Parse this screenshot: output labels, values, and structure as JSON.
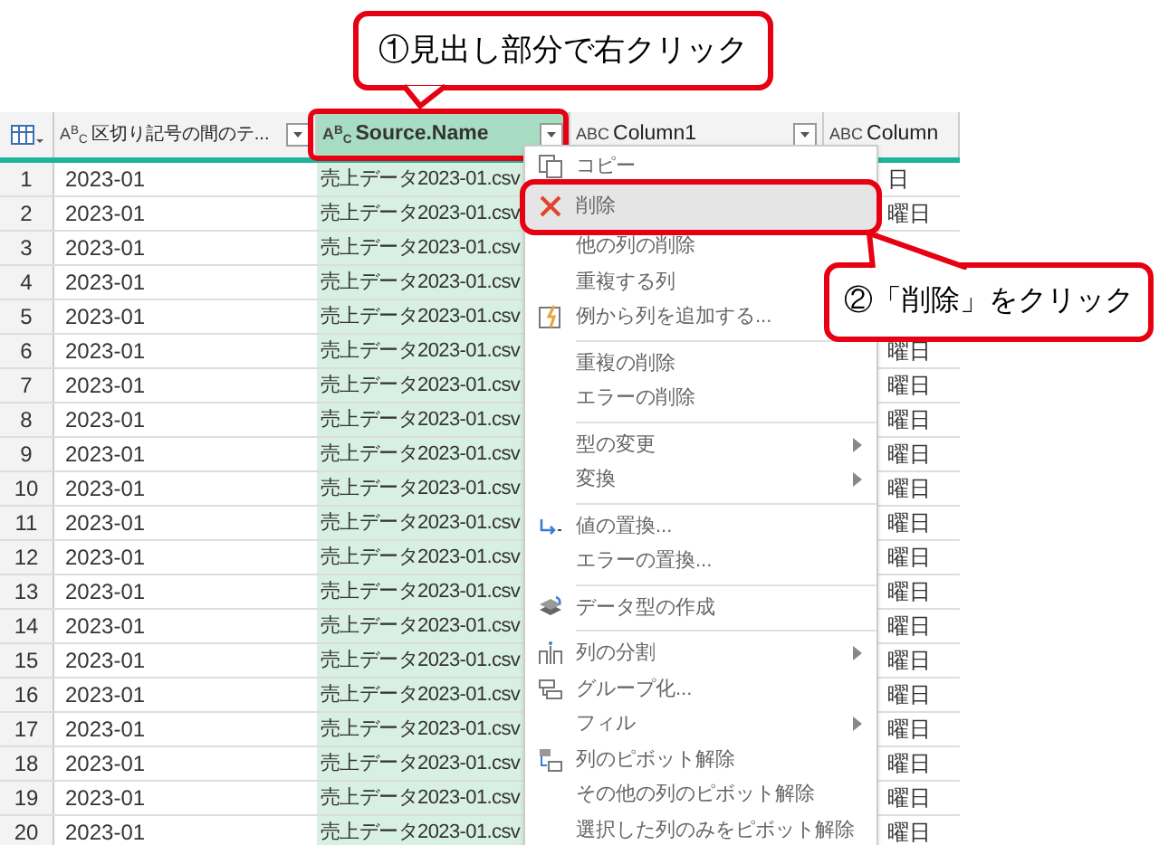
{
  "callouts": [
    {
      "kind": "tail-down",
      "text": "①見出し部分で右クリック"
    },
    {
      "kind": "tail-left",
      "text": "②「削除」をクリック"
    }
  ],
  "table": {
    "columns": [
      {
        "type": "A$^{B}$$_{C}$",
        "label": "区切り記号の間のテ...",
        "selected": false
      },
      {
        "type": "A$^{B}$$_{C}$",
        "label": "Source.Name",
        "selected": true
      },
      {
        "type": "ABC",
        "label": "Column1",
        "selected": false
      },
      {
        "type": "ABC",
        "label": "Column",
        "selected": false
      }
    ],
    "rows": [
      {
        "num": "1",
        "column_1": "2023-01",
        "column_2": "売上データ2023-01.csv",
        "column_4": "日"
      },
      {
        "num": "2",
        "column_1": "2023-01",
        "column_2": "売上データ2023-01.csv",
        "column_4": "曜日"
      },
      {
        "num": "3",
        "column_1": "2023-01",
        "column_2": "売上データ2023-01.csv"
      },
      {
        "num": "4",
        "column_1": "2023-01",
        "column_2": "売上データ2023-01.csv"
      },
      {
        "num": "5",
        "column_1": "2023-01",
        "column_2": "売上データ2023-01.csv"
      },
      {
        "num": "6",
        "column_1": "2023-01",
        "column_2": "売上データ2023-01.csv",
        "column_4": "曜日"
      },
      {
        "num": "7",
        "column_1": "2023-01",
        "column_2": "売上データ2023-01.csv",
        "column_4": "曜日"
      },
      {
        "num": "8",
        "column_1": "2023-01",
        "column_2": "売上データ2023-01.csv",
        "column_4": "曜日"
      },
      {
        "num": "9",
        "column_1": "2023-01",
        "column_2": "売上データ2023-01.csv",
        "column_4": "曜日"
      },
      {
        "num": "10",
        "column_1": "2023-01",
        "column_2": "売上データ2023-01.csv",
        "column_4": "曜日"
      },
      {
        "num": "11",
        "column_1": "2023-01",
        "column_2": "売上データ2023-01.csv",
        "column_4": "曜日"
      },
      {
        "num": "12",
        "column_1": "2023-01",
        "column_2": "売上データ2023-01.csv",
        "column_4": "曜日"
      },
      {
        "num": "13",
        "column_1": "2023-01",
        "column_2": "売上データ2023-01.csv",
        "column_4": "曜日"
      },
      {
        "num": "14",
        "column_1": "2023-01",
        "column_2": "売上データ2023-01.csv",
        "column_4": "曜日"
      },
      {
        "num": "15",
        "column_1": "2023-01",
        "column_2": "売上データ2023-01.csv",
        "column_4": "曜日"
      },
      {
        "num": "16",
        "column_1": "2023-01",
        "column_2": "売上データ2023-01.csv",
        "column_4": "曜日"
      },
      {
        "num": "17",
        "column_1": "2023-01",
        "column_2": "売上データ2023-01.csv",
        "column_4": "曜日"
      },
      {
        "num": "18",
        "column_1": "2023-01",
        "column_2": "売上データ2023-01.csv",
        "column_4": "曜日"
      },
      {
        "num": "19",
        "column_1": "2023-01",
        "column_2": "売上データ2023-01.csv",
        "column_4": "曜日"
      },
      {
        "num": "20",
        "column_1": "2023-01",
        "column_2": "売上データ2023-01.csv",
        "column_4": "曜日"
      }
    ]
  },
  "context_menu": {
    "items": [
      {
        "kind": "copy",
        "label": "コピー",
        "selected": false,
        "submenu": false
      },
      {
        "kind": "delete",
        "label": "削除",
        "selected": true,
        "submenu": false
      },
      {
        "kind": "plain",
        "label": "他の列の削除",
        "selected": false,
        "submenu": false
      },
      {
        "kind": "plain",
        "label": "重複する列",
        "selected": false,
        "submenu": false
      },
      {
        "kind": "example",
        "label": "例から列を追加する...",
        "selected": false,
        "submenu": false
      },
      {
        "kind": "separator"
      },
      {
        "kind": "plain",
        "label": "重複の削除",
        "selected": false,
        "submenu": false
      },
      {
        "kind": "plain",
        "label": "エラーの削除",
        "selected": false,
        "submenu": false
      },
      {
        "kind": "separator"
      },
      {
        "kind": "plain",
        "label": "型の変更",
        "selected": false,
        "submenu": true
      },
      {
        "kind": "plain",
        "label": "変換",
        "selected": false,
        "submenu": true
      },
      {
        "kind": "separator"
      },
      {
        "kind": "replace",
        "label": "値の置換...",
        "selected": false,
        "submenu": false
      },
      {
        "kind": "plain",
        "label": "エラーの置換...",
        "selected": false,
        "submenu": false
      },
      {
        "kind": "separator"
      },
      {
        "kind": "datatype",
        "label": "データ型の作成",
        "selected": false,
        "submenu": false
      },
      {
        "kind": "separator"
      },
      {
        "kind": "split",
        "label": "列の分割",
        "selected": false,
        "submenu": true
      },
      {
        "kind": "group",
        "label": "グループ化...",
        "selected": false,
        "submenu": false
      },
      {
        "kind": "plain",
        "label": "フィル",
        "selected": false,
        "submenu": true
      },
      {
        "kind": "unpivot",
        "label": "列のピボット解除",
        "selected": false,
        "submenu": false
      },
      {
        "kind": "plain",
        "label": "その他の列のピボット解除",
        "selected": false,
        "submenu": false
      },
      {
        "kind": "plain",
        "label": "選択した列のみをピボット解除",
        "selected": false,
        "submenu": false
      }
    ]
  }
}
